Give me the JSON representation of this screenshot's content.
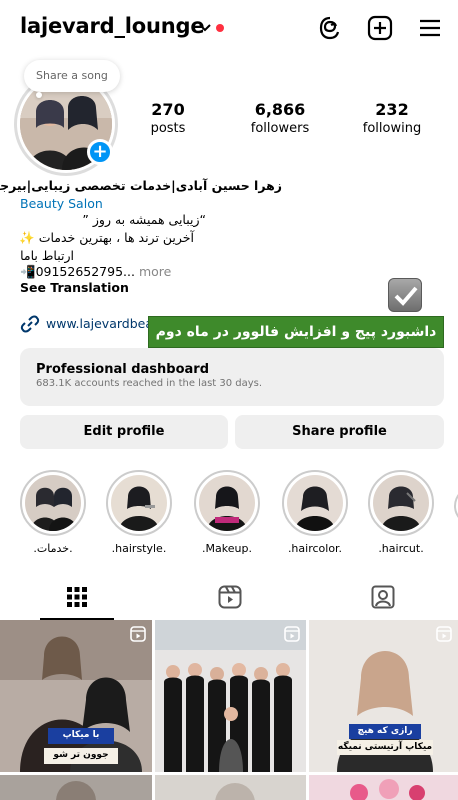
{
  "header": {
    "username": "lajevard_lounge"
  },
  "note": {
    "text": "Share a song"
  },
  "stats": [
    {
      "value": "270",
      "label": "posts"
    },
    {
      "value": "6,866",
      "label": "followers"
    },
    {
      "value": "232",
      "label": "following"
    }
  ],
  "bio": {
    "name": "زهرا حسین آبادی|خدمات تخصصی زیبایی|بیرجند",
    "category": "Beauty Salon",
    "line1": "“زیبایی همیشه به روز ”",
    "line2": "آخرین ترند ها ، بهترین خدمات ✨",
    "line3": "ارتباط باما",
    "phone": "📲09152652795...",
    "more": " more",
    "see_translation": "See Translation"
  },
  "link": {
    "text": "www.lajevardbea"
  },
  "promo_banner": {
    "text": "داشبورد پیج و افزایش فالوور در ماه دوم"
  },
  "dashboard": {
    "title": "Professional dashboard",
    "subtitle": "683.1K accounts reached in the last 30 days."
  },
  "buttons": {
    "edit": "Edit profile",
    "share": "Share profile"
  },
  "highlights": [
    {
      "label": ".خدمات."
    },
    {
      "label": ".hairstyle."
    },
    {
      "label": ".Makeup."
    },
    {
      "label": ".haircolor."
    },
    {
      "label": ".haircut."
    }
  ],
  "grid": {
    "post1_caption_top": "با میکاپ",
    "post1_caption_bottom": "جوون تر شو",
    "post3_caption_top": "رازی که هیچ",
    "post3_caption_bottom": "میکاپ آرتیستی نمیگه"
  },
  "colors": {
    "accent_blue": "#0095f6",
    "link_blue": "#00376b",
    "notification_red": "#ff3040",
    "promo_green": "#3e8a2b"
  }
}
